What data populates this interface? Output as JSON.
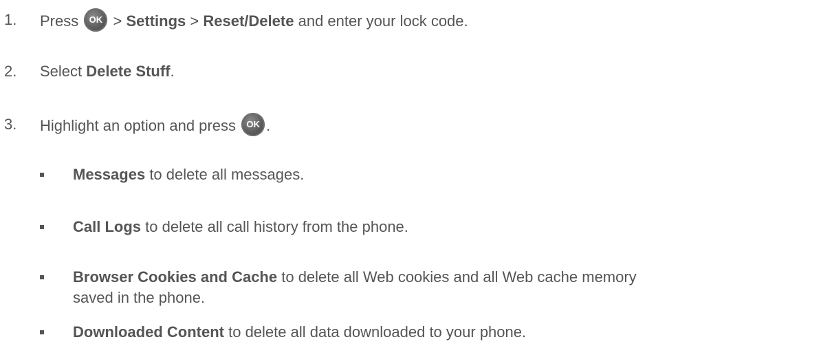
{
  "steps": [
    {
      "number": "1.",
      "pre": "Press",
      "button": "OK",
      "sep1": ">",
      "bold1": "Settings",
      "sep2": ">",
      "bold2": "Reset/Delete",
      "post": "and enter your lock code."
    },
    {
      "number": "2.",
      "pre": "Select",
      "bold": "Delete Stuff",
      "post": "."
    },
    {
      "number": "3.",
      "pre": "Highlight an option and press",
      "button": "OK",
      "post": "."
    }
  ],
  "options": [
    {
      "name": "Messages",
      "desc": "to delete all messages."
    },
    {
      "name": "Call Logs",
      "desc": "to delete all call history from the phone."
    },
    {
      "name": "Browser Cookies and Cache",
      "desc": "to delete all Web cookies and all Web cache memory",
      "desc_line2": "saved in the phone."
    },
    {
      "name": "Downloaded Content",
      "desc": "to delete all data downloaded to your phone."
    }
  ]
}
